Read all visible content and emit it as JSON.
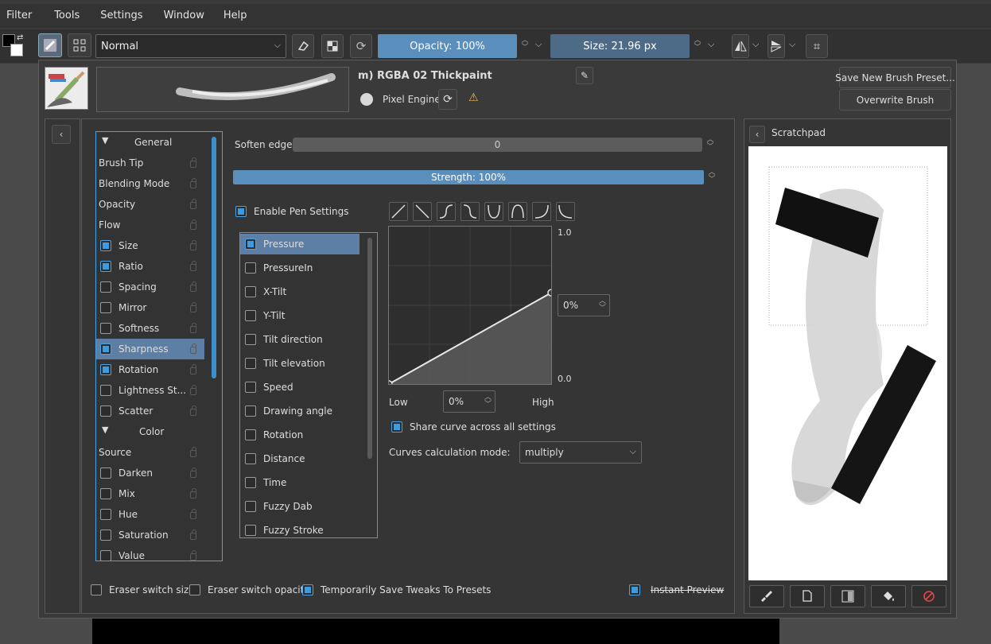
{
  "menubar": {
    "items": [
      "Filter",
      "Tools",
      "Settings",
      "Window",
      "Help"
    ]
  },
  "toolbar": {
    "blend_mode": "Normal",
    "opacity_label": "Opacity: 100%",
    "size_label": "Size: 21.96 px"
  },
  "preset": {
    "name": "m) RGBA 02 Thickpaint",
    "engine_label": "Pixel Engine",
    "save_new_label": "Save New Brush Preset...",
    "overwrite_label": "Overwrite Brush"
  },
  "options": {
    "general_header": "General",
    "color_header": "Color",
    "general_items": [
      {
        "label": "Brush Tip"
      },
      {
        "label": "Blending Mode"
      },
      {
        "label": "Opacity"
      },
      {
        "label": "Flow"
      },
      {
        "label": "Size",
        "checked": true
      },
      {
        "label": "Ratio",
        "checked": true
      },
      {
        "label": "Spacing",
        "checked": false
      },
      {
        "label": "Mirror",
        "checked": false
      },
      {
        "label": "Softness",
        "checked": false
      },
      {
        "label": "Sharpness",
        "checked": true,
        "selected": true
      },
      {
        "label": "Rotation",
        "checked": true
      },
      {
        "label": "Lightness St...",
        "checked": false
      },
      {
        "label": "Scatter",
        "checked": false
      }
    ],
    "color_items": [
      {
        "label": "Source"
      },
      {
        "label": "Darken",
        "checked": false
      },
      {
        "label": "Mix",
        "checked": false
      },
      {
        "label": "Hue",
        "checked": false
      },
      {
        "label": "Saturation",
        "checked": false
      },
      {
        "label": "Value",
        "checked": false
      }
    ]
  },
  "settings": {
    "soften_edge_label": "Soften edge:",
    "soften_edge_value": "0",
    "strength_label": "Strength: 100%",
    "strength_fraction": 1.0,
    "enable_pen_label": "Enable Pen Settings",
    "sensors": [
      {
        "label": "Pressure",
        "checked": true,
        "selected": true
      },
      {
        "label": "PressureIn",
        "checked": false
      },
      {
        "label": "X-Tilt",
        "checked": false
      },
      {
        "label": "Y-Tilt",
        "checked": false
      },
      {
        "label": "Tilt direction",
        "checked": false
      },
      {
        "label": "Tilt elevation",
        "checked": false
      },
      {
        "label": "Speed",
        "checked": false
      },
      {
        "label": "Drawing angle",
        "checked": false
      },
      {
        "label": "Rotation",
        "checked": false
      },
      {
        "label": "Distance",
        "checked": false
      },
      {
        "label": "Time",
        "checked": false
      },
      {
        "label": "Fuzzy Dab",
        "checked": false
      },
      {
        "label": "Fuzzy Stroke",
        "checked": false
      }
    ],
    "curve_presets": [
      "linear-up-icon",
      "linear-down-icon",
      "s-curve-icon",
      "reverse-s-curve-icon",
      "u-curve-icon",
      "arch-curve-icon",
      "concave-curve-icon",
      "convex-curve-icon"
    ],
    "curve_max": "1.0",
    "curve_min": "0.0",
    "curve_value": "0%",
    "curve_points": [
      [
        0,
        0
      ],
      [
        1,
        0.58
      ]
    ],
    "low_label": "Low",
    "high_label": "High",
    "range_value": "0%",
    "share_curve_label": "Share curve across all settings",
    "calc_mode_label": "Curves calculation mode:",
    "calc_mode_value": "multiply"
  },
  "footer": {
    "eraser_size_label": "Eraser switch size",
    "eraser_opacity_label": "Eraser switch opacity",
    "save_tweaks_label": "Temporarily Save Tweaks To Presets",
    "instant_preview_label": "Instant Preview"
  },
  "scratchpad": {
    "title": "Scratchpad",
    "tools": [
      "brush-icon",
      "clear-page-icon",
      "gradient-icon",
      "bucket-fill-icon",
      "reset-icon"
    ]
  },
  "colors": {
    "accent": "#3d9be0",
    "bar": "#5a8fbd",
    "selection": "#5e7fa5"
  }
}
